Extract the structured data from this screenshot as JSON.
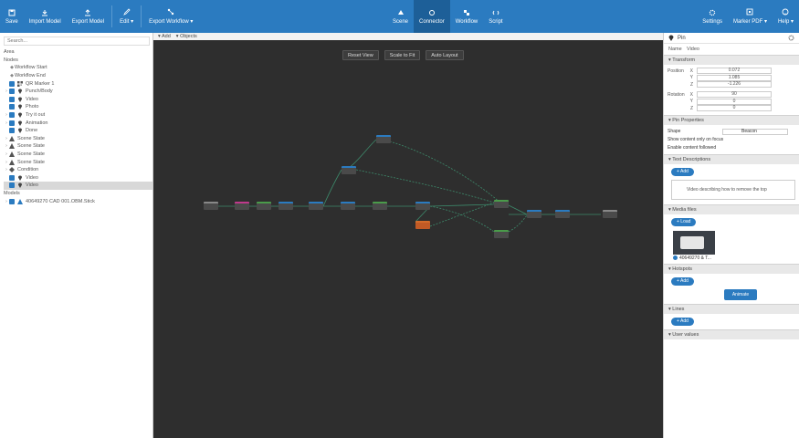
{
  "toolbar": {
    "left": [
      {
        "label": "Save",
        "icon": "save-icon"
      },
      {
        "label": "Import Model",
        "icon": "import-icon"
      },
      {
        "label": "Export Model",
        "icon": "export-icon"
      },
      {
        "label": "Edit ▾",
        "icon": "edit-icon"
      },
      {
        "label": "Export Workflow ▾",
        "icon": "workflow-icon"
      }
    ],
    "center": [
      {
        "label": "Scene",
        "icon": "scene-icon"
      },
      {
        "label": "Connector",
        "icon": "connector-icon"
      },
      {
        "label": "Workflow",
        "icon": "workflow-view-icon"
      },
      {
        "label": "Script",
        "icon": "script-icon"
      }
    ],
    "right": [
      {
        "label": "Settings",
        "icon": "settings-icon"
      },
      {
        "label": "Marker PDF ▾",
        "icon": "marker-icon"
      },
      {
        "label": "Help ▾",
        "icon": "help-icon"
      }
    ]
  },
  "left_panel": {
    "search_placeholder": "Search...",
    "section_label": "Area",
    "nodes_label": "Nodes",
    "models_label": "Models",
    "tree": [
      {
        "label": "Workflow Start",
        "type": "plain"
      },
      {
        "label": "Workflow End",
        "type": "plain"
      },
      {
        "label": "QR Marker 1",
        "type": "qr"
      },
      {
        "label": "Punch/Body",
        "type": "pin"
      },
      {
        "label": "Video",
        "type": "pin"
      },
      {
        "label": "Photo",
        "type": "pin"
      },
      {
        "label": "Try it out",
        "type": "pin"
      },
      {
        "label": "Animation",
        "type": "pin"
      },
      {
        "label": "Done",
        "type": "pin"
      },
      {
        "label": "Scene State",
        "type": "scene"
      },
      {
        "label": "Scene State",
        "type": "scene"
      },
      {
        "label": "Scene State",
        "type": "scene"
      },
      {
        "label": "Scene State",
        "type": "scene"
      },
      {
        "label": "Condition",
        "type": "cond"
      },
      {
        "label": "Video",
        "type": "pin"
      },
      {
        "label": "Video",
        "type": "pin",
        "selected": true
      }
    ],
    "model_item": "40649270 CAD 001.OBM.Stick"
  },
  "canvas": {
    "header": [
      "▾ Add",
      "▾ Objects"
    ],
    "buttons": [
      "Reset View",
      "Scale to Fit",
      "Auto Layout"
    ]
  },
  "right_panel": {
    "title": "Pin",
    "name_label": "Name",
    "name_value": "Video",
    "transform_label": "▾ Transform",
    "position_label": "Position",
    "position": [
      {
        "axis": "X",
        "value": "0.072"
      },
      {
        "axis": "Y",
        "value": "1.085"
      },
      {
        "axis": "Z",
        "value": "-1.226"
      }
    ],
    "rotation_label": "Rotation",
    "rotation": [
      {
        "axis": "X",
        "value": "90"
      },
      {
        "axis": "Y",
        "value": "0"
      },
      {
        "axis": "Z",
        "value": "0"
      }
    ],
    "pin_props_label": "▾ Pin Properties",
    "shape_label": "Shape",
    "shape_value": "Beacon",
    "show_focus_label": "Show content only on focus",
    "enable_follow_label": "Enable content followed",
    "text_desc_label": "▾ Text Descriptions",
    "add_label": "+ Add",
    "desc_text": "Video describing how to remove the top",
    "media_label": "▾ Media files",
    "load_label": "+ Load",
    "media_file": "40649270 & T...",
    "hotspots_label": "▾ Hotspots",
    "animate_label": "Animate",
    "lines_label": "▾ Lines",
    "user_values_label": "▾ User values"
  }
}
